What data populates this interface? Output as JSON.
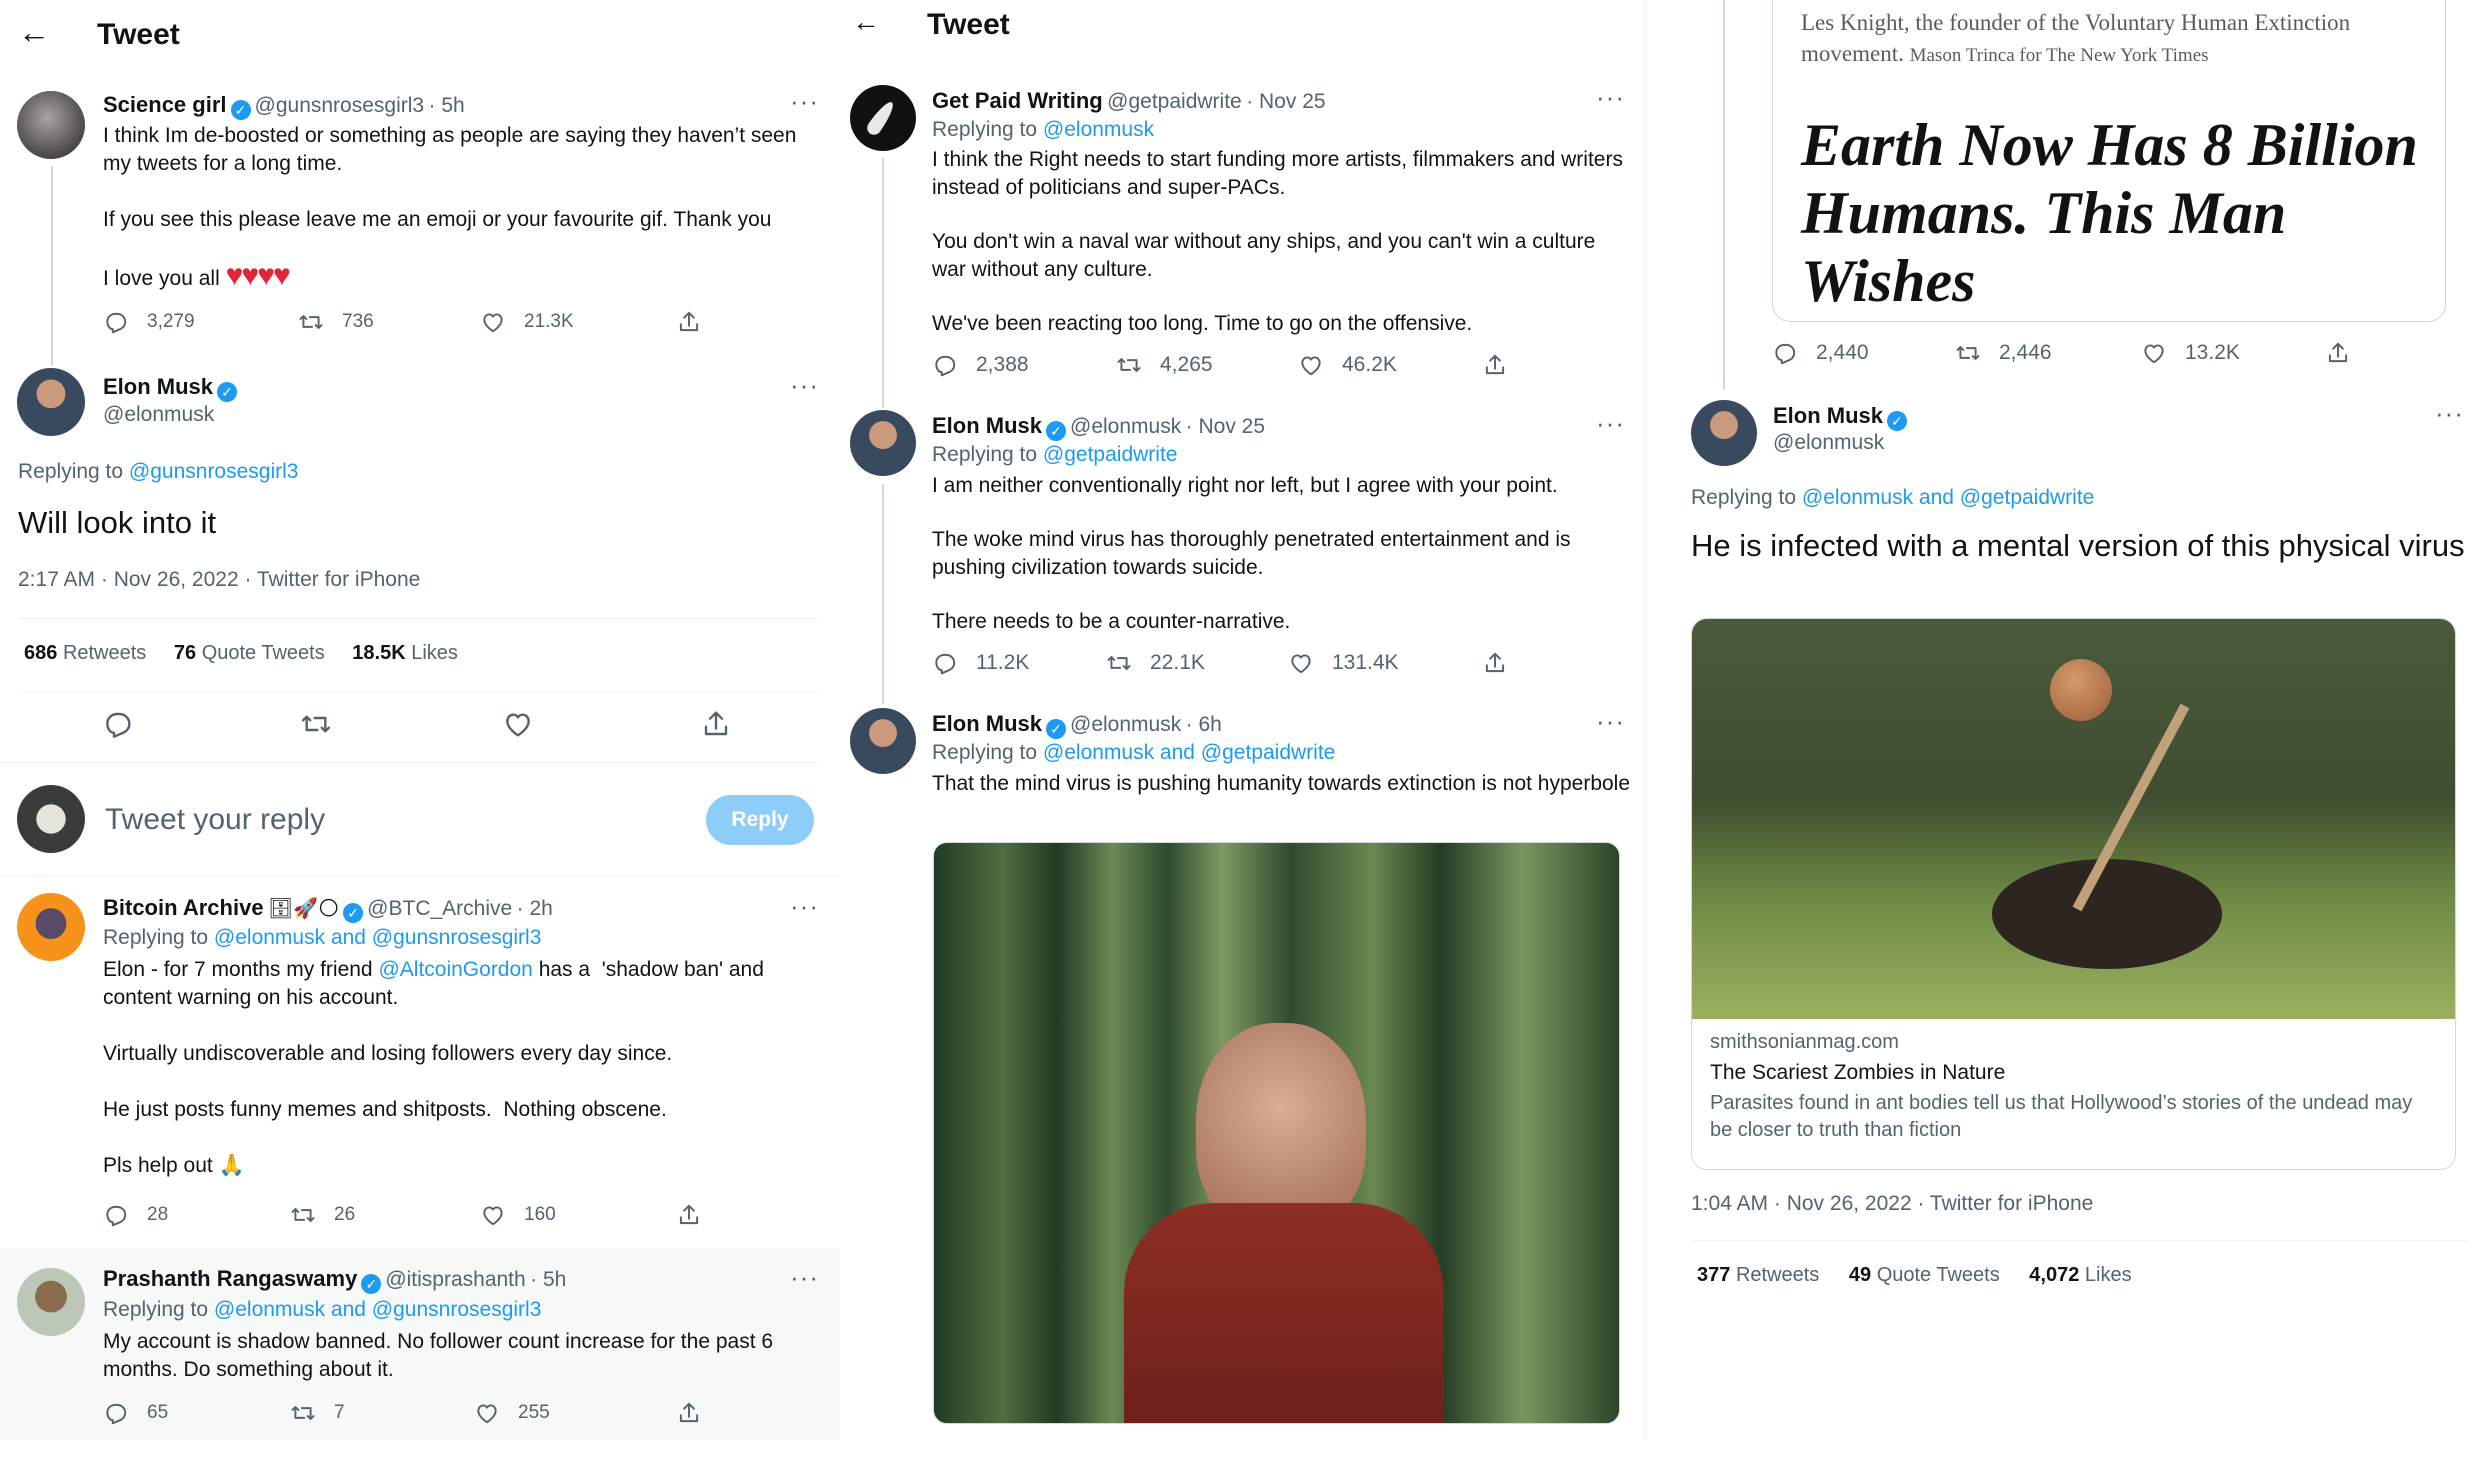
{
  "panel1": {
    "header_title": "Tweet",
    "tweet1": {
      "name": "Science girl",
      "handle": "@gunsnrosesgirl3",
      "time": "· 5h",
      "text1": "I think Im de-boosted or something as people are saying they haven’t seen my tweets for a long time.",
      "text2": "If you see this please leave me an emoji or your favourite gif. Thank you",
      "text3": "I love you all",
      "hearts": "♥♥♥♥",
      "replies": "3,279",
      "retweets": "736",
      "likes": "21.3K"
    },
    "main": {
      "name": "Elon Musk",
      "handle": "@elonmusk",
      "replying_prefix": "Replying to",
      "replying_to": "@gunsnrosesgirl3",
      "text": "Will look into it",
      "meta": "2:17 AM · Nov 26, 2022 · Twitter for iPhone",
      "retweets_count": "686",
      "retweets_label": "Retweets",
      "quotes_count": "76",
      "quotes_label": "Quote Tweets",
      "likes_count": "18.5K",
      "likes_label": "Likes"
    },
    "reply_box": {
      "placeholder": "Tweet your reply",
      "button": "Reply"
    },
    "tweet2": {
      "name": "Bitcoin Archive",
      "emoji": "🗄🚀🌕",
      "handle": "@BTC_Archive",
      "time": "· 2h",
      "replying_prefix": "Replying to",
      "replying_to": "@elonmusk and @gunsnrosesgirl3",
      "text1a": "Elon - for 7 months my friend ",
      "mention": "@AltcoinGordon",
      "text1b": " has a  'shadow ban' and content warning on his account.",
      "text2": "Virtually undiscoverable and losing followers every day since.",
      "text3": "He just posts funny memes and shitposts.  Nothing obscene.",
      "text4": "Pls help out 🙏",
      "replies": "28",
      "retweets": "26",
      "likes": "160"
    },
    "tweet3": {
      "name": "Prashanth Rangaswamy",
      "handle": "@itisprashanth",
      "time": "· 5h",
      "replying_prefix": "Replying to",
      "replying_to": "@elonmusk and @gunsnrosesgirl3",
      "text": "My account is shadow banned. No follower count increase for the past 6 months. Do something about it.",
      "replies": "65",
      "retweets": "7",
      "likes": "255"
    }
  },
  "panel2": {
    "header_title": "Tweet",
    "tweet1": {
      "name": "Get Paid Writing",
      "handle": "@getpaidwrite",
      "time": "· Nov 25",
      "replying_prefix": "Replying to",
      "replying_to": "@elonmusk",
      "text1": "I think the Right needs to start funding more artists, filmmakers and writers instead of politicians and super-PACs.",
      "text2": "You don't win a naval war without any ships, and you can't win a culture war without any culture.",
      "text3": "We've been reacting too long. Time to go on the offensive.",
      "replies": "2,388",
      "retweets": "4,265",
      "likes": "46.2K"
    },
    "tweet2": {
      "name": "Elon Musk",
      "handle": "@elonmusk",
      "time": "· Nov 25",
      "replying_prefix": "Replying to",
      "replying_to": "@getpaidwrite",
      "text1": "I am neither conventionally right nor left, but I agree with your point.",
      "text2": "The woke mind virus has thoroughly penetrated entertainment and is pushing civilization towards suicide.",
      "text3": "There needs to be a counter-narrative.",
      "replies": "11.2K",
      "retweets": "22.1K",
      "likes": "131.4K"
    },
    "tweet3": {
      "name": "Elon Musk",
      "handle": "@elonmusk",
      "time": "· 6h",
      "replying_prefix": "Replying to",
      "replying_to": "@elonmusk and @getpaidwrite",
      "text": "That the mind virus is pushing humanity towards extinction is not hyperbole"
    }
  },
  "panel3": {
    "article_caption": "Les Knight, the founder of the Voluntary Human Extinction movement.",
    "article_credit": "Mason Trinca for The New York Times",
    "article_headline": "Earth Now Has 8 Billion Humans. This Man Wishes",
    "quoted_stats": {
      "replies": "2,440",
      "retweets": "2,446",
      "likes": "13.2K"
    },
    "main": {
      "name": "Elon Musk",
      "handle": "@elonmusk",
      "replying_prefix": "Replying to",
      "replying_to": "@elonmusk and @getpaidwrite",
      "text": "He is infected with a mental version of this physical virus",
      "card_domain": "smithsonianmag.com",
      "card_title": "The Scariest Zombies in Nature",
      "card_desc": "Parasites found in ant bodies tell us that Hollywood’s stories of the undead may be closer to truth than fiction",
      "meta": "1:04 AM · Nov 26, 2022 · Twitter for iPhone",
      "retweets_count": "377",
      "retweets_label": "Retweets",
      "quotes_count": "49",
      "quotes_label": "Quote Tweets",
      "likes_count": "4,072",
      "likes_label": "Likes"
    }
  },
  "colors": {
    "accent": "#1d9bf0",
    "secondary_text": "#536471",
    "heart": "#f91880"
  }
}
